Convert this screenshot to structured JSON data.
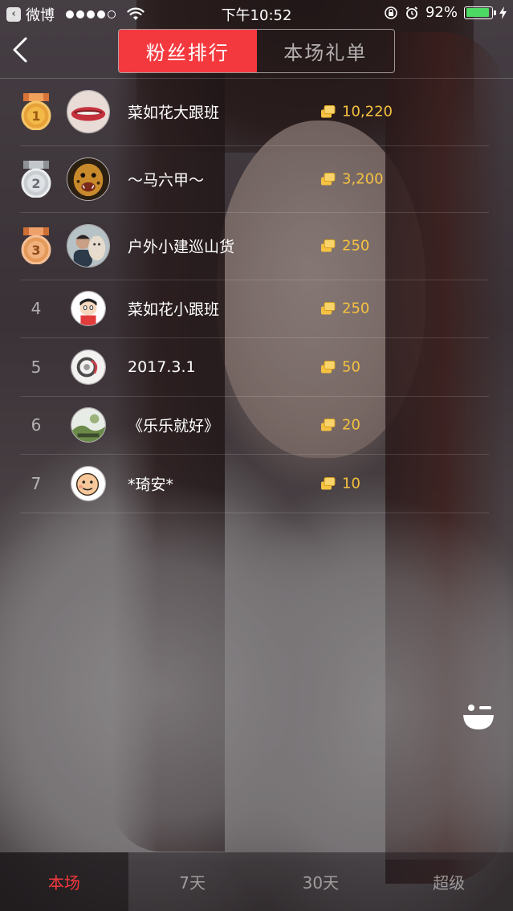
{
  "status_bar": {
    "back_app": "微博",
    "time": "下午10:52",
    "battery": "92%",
    "battery_level": 0.92
  },
  "header": {
    "tabs": [
      {
        "label": "粉丝排行",
        "active": true
      },
      {
        "label": "本场礼单",
        "active": false
      }
    ]
  },
  "ranking": [
    {
      "rank": "1",
      "name": "菜如花大跟班",
      "amount": "10,220"
    },
    {
      "rank": "2",
      "name": "～马六甲～",
      "amount": "3,200"
    },
    {
      "rank": "3",
      "name": "户外小建巡山货",
      "amount": "250"
    },
    {
      "rank": "4",
      "name": "菜如花小跟班",
      "amount": "250"
    },
    {
      "rank": "5",
      "name": "2017.3.1",
      "amount": "50"
    },
    {
      "rank": "6",
      "name": "《乐乐就好》",
      "amount": "20"
    },
    {
      "rank": "7",
      "name": "*琦安*",
      "amount": "10"
    }
  ],
  "bottom_tabs": [
    {
      "label": "本场",
      "active": true
    },
    {
      "label": "7天",
      "active": false
    },
    {
      "label": "30天",
      "active": false
    },
    {
      "label": "超级",
      "active": false
    }
  ],
  "colors": {
    "accent": "#f4393e",
    "amount": "#f6c241",
    "gold": "#e8a23a",
    "silver": "#c9ccd1",
    "bronze": "#e59a5a"
  },
  "icons": [
    "back-chevron-icon",
    "medal-gold-icon",
    "medal-silver-icon",
    "medal-bronze-icon",
    "coins-icon",
    "emoji-wink-icon"
  ]
}
